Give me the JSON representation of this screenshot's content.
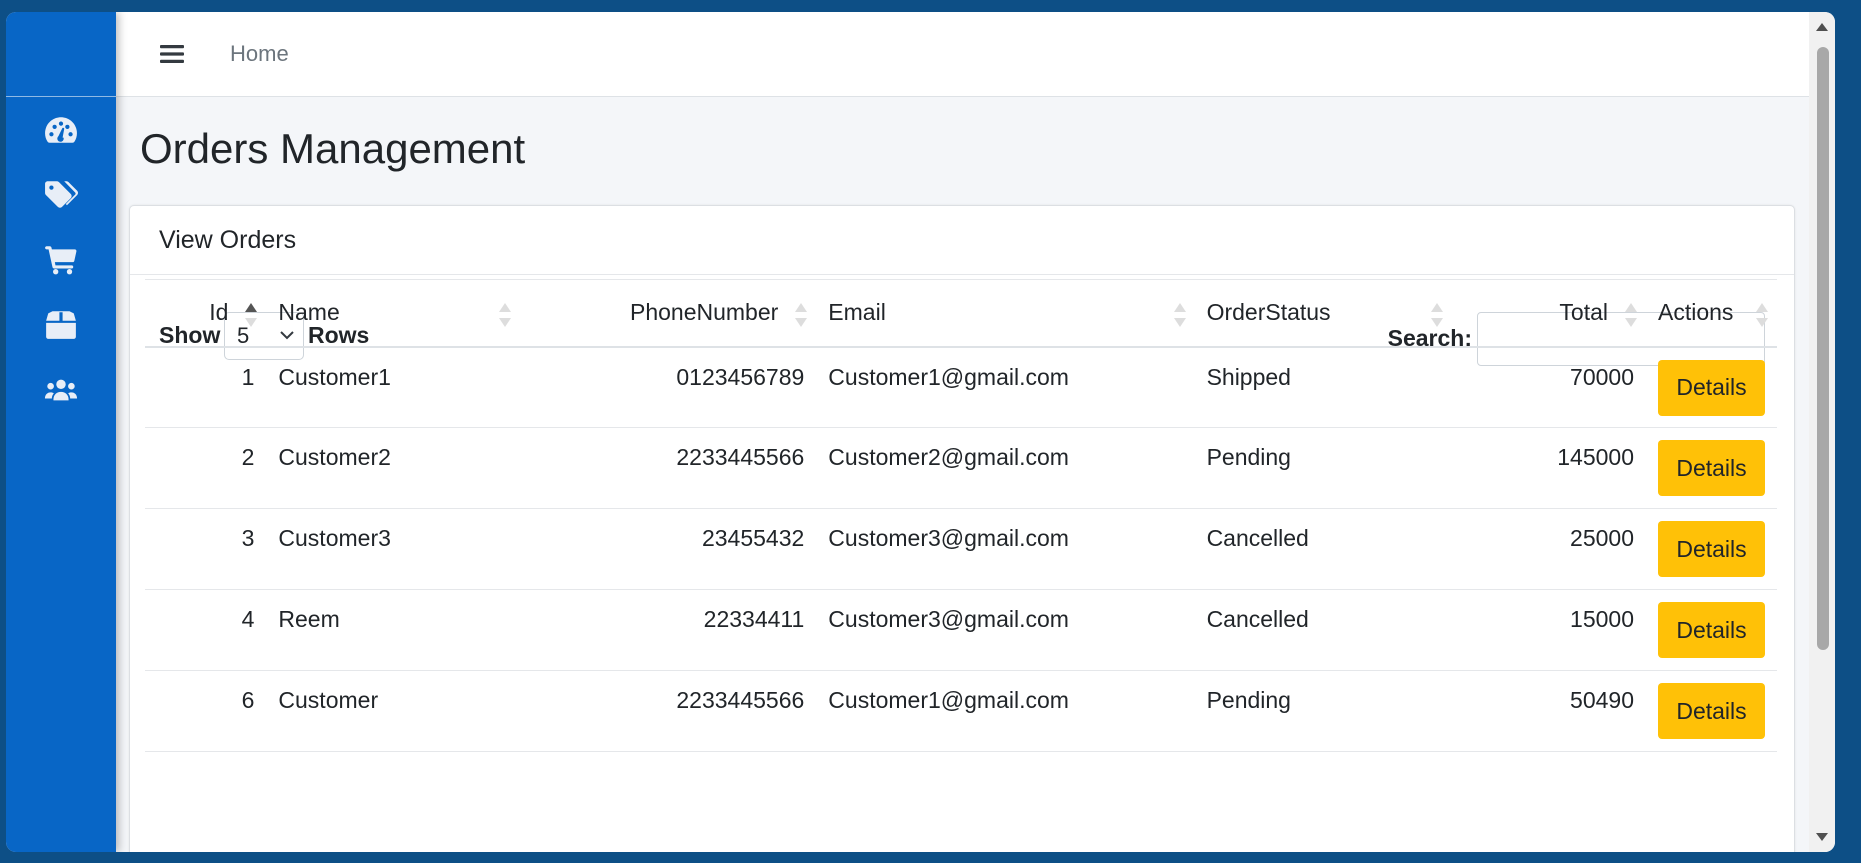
{
  "topbar": {
    "home_label": "Home"
  },
  "page": {
    "title": "Orders Management"
  },
  "card": {
    "header": "View Orders"
  },
  "controls": {
    "show_label": "Show",
    "rows_value": "5",
    "rows_label": "Rows",
    "search_label": "Search:",
    "search_value": ""
  },
  "sidebar": {
    "items": [
      {
        "icon": "dashboard-icon"
      },
      {
        "icon": "tags-icon"
      },
      {
        "icon": "cart-icon"
      },
      {
        "icon": "box-icon"
      },
      {
        "icon": "users-icon"
      }
    ]
  },
  "table": {
    "headers": [
      "Id",
      "Name",
      "PhoneNumber",
      "Email",
      "OrderStatus",
      "Total",
      "Actions"
    ],
    "rows": [
      {
        "id": "1",
        "name": "Customer1",
        "phone": "0123456789",
        "email": "Customer1@gmail.com",
        "status": "Shipped",
        "total": "70000",
        "action": "Details"
      },
      {
        "id": "2",
        "name": "Customer2",
        "phone": "2233445566",
        "email": "Customer2@gmail.com",
        "status": "Pending",
        "total": "145000",
        "action": "Details"
      },
      {
        "id": "3",
        "name": "Customer3",
        "phone": "23455432",
        "email": "Customer3@gmail.com",
        "status": "Cancelled",
        "total": "25000",
        "action": "Details"
      },
      {
        "id": "4",
        "name": "Reem",
        "phone": "22334411",
        "email": "Customer3@gmail.com",
        "status": "Cancelled",
        "total": "15000",
        "action": "Details"
      },
      {
        "id": "6",
        "name": "Customer",
        "phone": "2233445566",
        "email": "Customer1@gmail.com",
        "status": "Pending",
        "total": "50490",
        "action": "Details"
      }
    ]
  },
  "colors": {
    "sidebar": "#0866c6",
    "details_button": "#ffc107",
    "desktop": "#0d4f86"
  }
}
